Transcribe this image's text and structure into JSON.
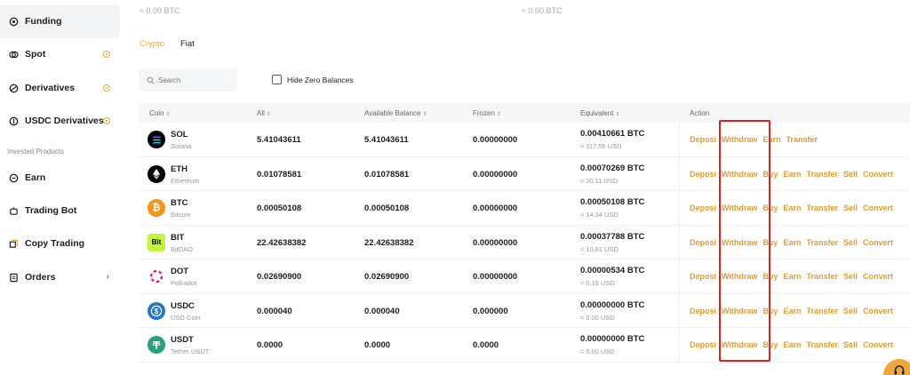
{
  "sidebar": {
    "items": [
      {
        "label": "Funding",
        "icon": "funding-icon"
      },
      {
        "label": "Spot",
        "icon": "spot-icon"
      },
      {
        "label": "Derivatives",
        "icon": "derivatives-icon"
      },
      {
        "label": "USDC Derivatives",
        "icon": "usdc-derivatives-icon"
      },
      {
        "label": "Earn",
        "icon": "earn-icon"
      },
      {
        "label": "Trading Bot",
        "icon": "trading-bot-icon"
      },
      {
        "label": "Copy Trading",
        "icon": "copy-trading-icon"
      },
      {
        "label": "Orders",
        "icon": "orders-icon"
      }
    ],
    "section_label": "Invested Products",
    "orders_chevron": "›"
  },
  "header": {
    "btc_left": "≈ 0.00 BTC",
    "btc_right": "≈ 0.00 BTC"
  },
  "tabs": {
    "crypto": "Crypto",
    "fiat": "Fiat"
  },
  "search": {
    "placeholder": "Search"
  },
  "hide_zero": {
    "label": "Hide Zero Balances"
  },
  "table": {
    "headers": [
      "Coin",
      "All",
      "Available Balance",
      "Frozen",
      "Equivalent",
      "Action"
    ],
    "sort_glyph": "⇕",
    "rows": [
      {
        "symbol": "SOL",
        "name": "Solana",
        "all": "5.41043611",
        "available": "5.41043611",
        "frozen": "0.00000000",
        "eq_btc": "0.00410661 BTC",
        "eq_usd": "≈ 117.56 USD",
        "color": "#000000"
      },
      {
        "symbol": "ETH",
        "name": "Ethereum",
        "all": "0.01078581",
        "available": "0.01078581",
        "frozen": "0.00000000",
        "eq_btc": "0.00070269 BTC",
        "eq_usd": "≈ 20.11 USD",
        "color": "#000000"
      },
      {
        "symbol": "BTC",
        "name": "Bitcoin",
        "all": "0.00050108",
        "available": "0.00050108",
        "frozen": "0.00000000",
        "eq_btc": "0.00050108 BTC",
        "eq_usd": "≈ 14.34 USD",
        "color": "#f7931a"
      },
      {
        "symbol": "BIT",
        "name": "BitDAO",
        "all": "22.42638382",
        "available": "22.42638382",
        "frozen": "0.00000000",
        "eq_btc": "0.00037788 BTC",
        "eq_usd": "≈ 10.81 USD",
        "color": "#c3f53c"
      },
      {
        "symbol": "DOT",
        "name": "Polkadot",
        "all": "0.02690900",
        "available": "0.02690900",
        "frozen": "0.00000000",
        "eq_btc": "0.00000534 BTC",
        "eq_usd": "≈ 0.15 USD",
        "color": "#e6007a"
      },
      {
        "symbol": "USDC",
        "name": "USD Coin",
        "all": "0.000040",
        "available": "0.000040",
        "frozen": "0.000000",
        "eq_btc": "0.00000000 BTC",
        "eq_usd": "≈ 0.00 USD",
        "color": "#2775ca"
      },
      {
        "symbol": "USDT",
        "name": "Tether USDT",
        "all": "0.0000",
        "available": "0.0000",
        "frozen": "0.0000",
        "eq_btc": "0.00000000 BTC",
        "eq_usd": "≈ 0.00 USD",
        "color": "#26a17b"
      }
    ],
    "actions_short": [
      "Deposi",
      "Withdraw",
      "Earn",
      "Transfer"
    ],
    "actions_full": [
      "Deposi",
      "Withdraw",
      "Buy",
      "Earn",
      "Transfer",
      "Sell",
      "Convert"
    ]
  },
  "colors": {
    "accent": "#f0a73a",
    "highlight": "#e0231e"
  }
}
